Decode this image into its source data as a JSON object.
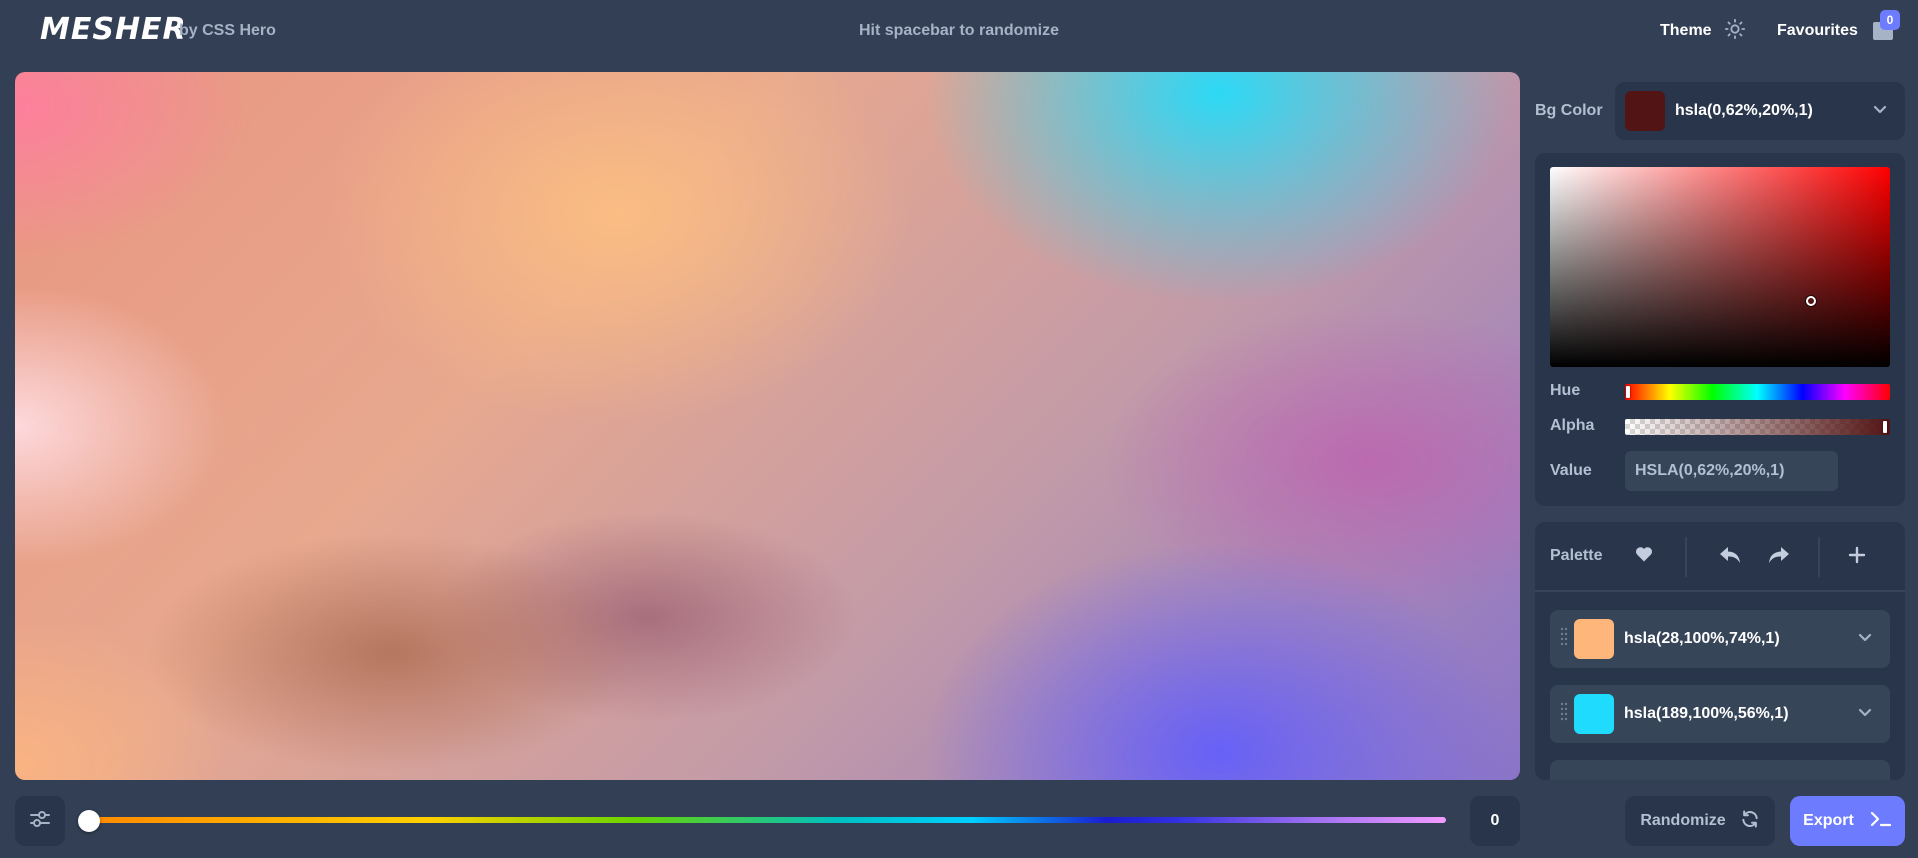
{
  "header": {
    "logo": "MESHER",
    "byline": "by CSS Hero",
    "hint": "Hit spacebar to randomize",
    "theme_label": "Theme",
    "favourites_label": "Favourites",
    "favourites_count": "0"
  },
  "bottom": {
    "hue_shift_value": "0",
    "randomize_label": "Randomize",
    "export_label": "Export"
  },
  "bg_color": {
    "label": "Bg Color",
    "value": "hsla(0,62%,20%,1)",
    "swatch": "#521414"
  },
  "picker": {
    "hue_label": "Hue",
    "alpha_label": "Alpha",
    "value_label": "Value",
    "value_input": "HSLA(0,62%,20%,1)"
  },
  "palette": {
    "title": "Palette",
    "items": [
      {
        "label": "hsla(28,100%,74%,1)",
        "color": "#ffb67a"
      },
      {
        "label": "hsla(189,100%,56%,1)",
        "color": "#1fdcff"
      }
    ]
  },
  "colors": {
    "accent": "#6d7cff",
    "panel": "#29354a",
    "background": "#323f54"
  }
}
